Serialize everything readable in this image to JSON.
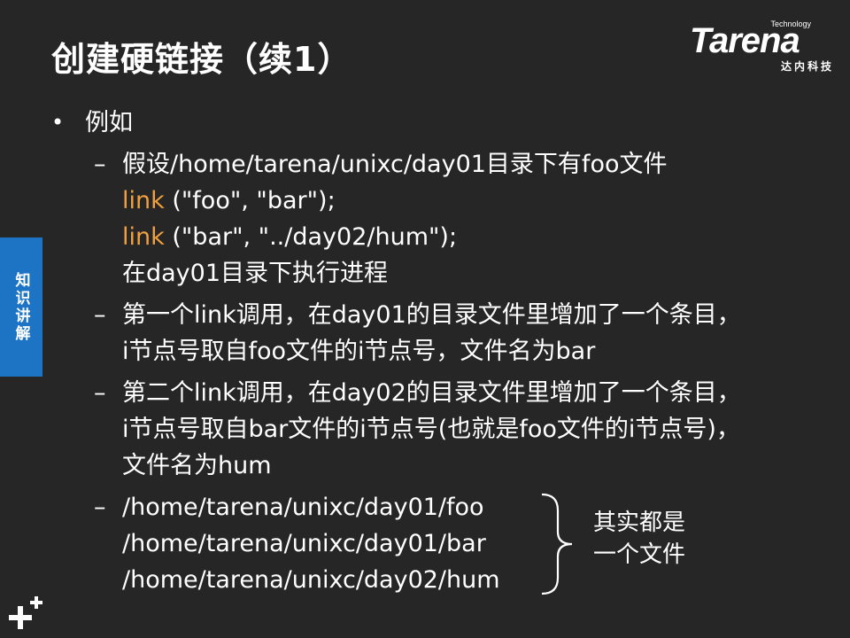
{
  "slide": {
    "title": "创建硬链接（续1）",
    "logo": {
      "tech": "Technology",
      "word": "Tarena",
      "sub": "达内科技"
    },
    "side_tab": "知识讲解",
    "bullet": {
      "text": "例如",
      "subitems": [
        {
          "lines": [
            {
              "plain": "假设/home/tarena/unixc/day01目录下有foo文件"
            },
            {
              "kw": "link",
              "rest": " (\"foo\", \"bar\");"
            },
            {
              "kw": "link",
              "rest": " (\"bar\", \"../day02/hum\");"
            },
            {
              "plain": "在day01目录下执行进程"
            }
          ]
        },
        {
          "lines": [
            {
              "plain": "第一个link调用，在day01的目录文件里增加了一个条目，"
            },
            {
              "plain": "i节点号取自foo文件的i节点号，文件名为bar"
            }
          ]
        },
        {
          "lines": [
            {
              "plain": "第二个link调用，在day02的目录文件里增加了一个条目，"
            },
            {
              "plain": "i节点号取自bar文件的i节点号(也就是foo文件的i节点号)，"
            },
            {
              "plain": "文件名为hum"
            }
          ]
        },
        {
          "paths": [
            "/home/tarena/unixc/day01/foo",
            "/home/tarena/unixc/day01/bar",
            "/home/tarena/unixc/day02/hum"
          ],
          "note": [
            "其实都是",
            "一个文件"
          ]
        }
      ]
    },
    "colors": {
      "background": "#262626",
      "text": "#ffffff",
      "keyword": "#f0a040",
      "side_tab": "#1e74c4"
    }
  }
}
